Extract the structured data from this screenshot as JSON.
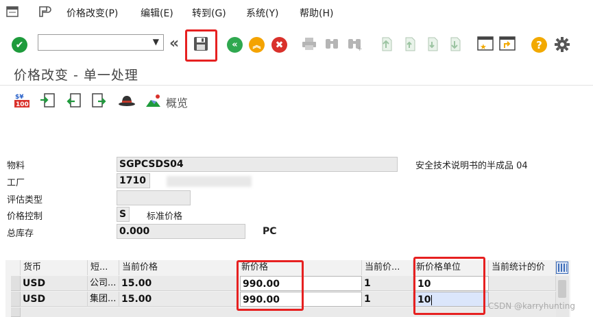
{
  "menu": {
    "items": [
      "价格改变(P)",
      "编辑(E)",
      "转到(G)",
      "系统(Y)",
      "帮助(H)"
    ]
  },
  "toolbar": {
    "command_value": ""
  },
  "title": "价格改变 - 单一处理",
  "app_toolbar": {
    "overview_label": "概览"
  },
  "form": {
    "material_label": "物料",
    "material_value": "SGPCSDS04",
    "material_desc": "安全技术说明书的半成品 04",
    "plant_label": "工厂",
    "plant_value": "1710",
    "valuation_type_label": "评估类型",
    "valuation_type_value": "",
    "price_control_label": "价格控制",
    "price_control_value": "S",
    "price_control_desc": "标准价格",
    "total_stock_label": "总库存",
    "total_stock_value": "0.000",
    "total_stock_unit": "PC"
  },
  "table": {
    "headers": [
      "货币",
      "短...",
      "当前价格",
      "新价格",
      "当前价...",
      "新价格单位",
      "当前统计的价"
    ],
    "rows": [
      [
        "USD",
        "公司...",
        "15.00",
        "990.00",
        "1",
        "10",
        ""
      ],
      [
        "USD",
        "集团...",
        "15.00",
        "990.00",
        "1",
        "10",
        ""
      ]
    ]
  },
  "watermark": "CSDN @karryhunting",
  "colors": {
    "highlight_border": "#e62020",
    "check_green": "#1e9b3c",
    "nav_green": "#2fa84f",
    "nav_orange": "#f4a300",
    "cancel_red": "#d9312b",
    "help_yellow": "#f2a900"
  }
}
